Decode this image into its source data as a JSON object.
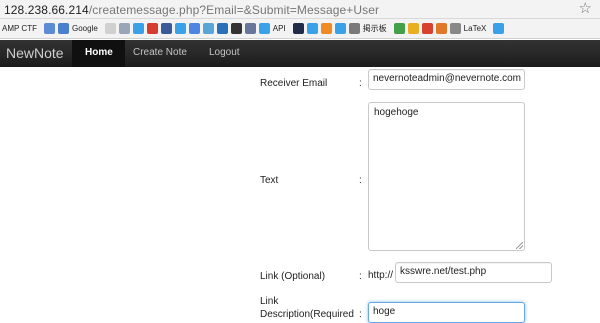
{
  "browser": {
    "url_host": "128.238.66.214",
    "url_path": "/createmessage.php?Email=&Submit=Message+User"
  },
  "bookmarks": [
    {
      "label": "AMP CTF",
      "icon": "none",
      "color": ""
    },
    {
      "label": "",
      "icon": "bookmark-icon",
      "color": "#5b8dd6"
    },
    {
      "label": "Google",
      "icon": "google-icon",
      "color": "#4a7fd0"
    },
    {
      "label": "",
      "icon": "page-icon",
      "color": "#d0d0d0"
    },
    {
      "label": "",
      "icon": "file-icon",
      "color": "#9aa6b8"
    },
    {
      "label": "",
      "icon": "twitter-icon",
      "color": "#3aa0e8"
    },
    {
      "label": "",
      "icon": "gmail-icon",
      "color": "#d63b2f"
    },
    {
      "label": "",
      "icon": "facebook-icon",
      "color": "#3b5998"
    },
    {
      "label": "",
      "icon": "twitter-icon",
      "color": "#3aa0e8"
    },
    {
      "label": "",
      "icon": "calendar-icon",
      "color": "#4c86e0"
    },
    {
      "label": "",
      "icon": "app-icon",
      "color": "#58a6d8"
    },
    {
      "label": "",
      "icon": "w3c-icon",
      "color": "#2a6fb8"
    },
    {
      "label": "",
      "icon": "github-icon",
      "color": "#333333"
    },
    {
      "label": "",
      "icon": "shield-icon",
      "color": "#667799"
    },
    {
      "label": "API",
      "icon": "twitter-icon",
      "color": "#3aa0e8"
    },
    {
      "label": "",
      "icon": "k-icon",
      "color": "#1f2d4a"
    },
    {
      "label": "",
      "icon": "twitter-icon",
      "color": "#3aa0e8"
    },
    {
      "label": "",
      "icon": "blogger-icon",
      "color": "#f08a24"
    },
    {
      "label": "",
      "icon": "twitter-icon",
      "color": "#3aa0e8"
    },
    {
      "label": "掲示板",
      "icon": "board-icon",
      "color": "#7a7a7a"
    },
    {
      "label": "",
      "icon": "chart-icon",
      "color": "#42a04a"
    },
    {
      "label": "",
      "icon": "wand-icon",
      "color": "#e8b020"
    },
    {
      "label": "",
      "icon": "mail-icon",
      "color": "#d84030"
    },
    {
      "label": "",
      "icon": "bag-icon",
      "color": "#e07828"
    },
    {
      "label": "LaTeX",
      "icon": "latex-icon",
      "color": "#888888"
    },
    {
      "label": "",
      "icon": "twitter-icon",
      "color": "#3aa0e8"
    }
  ],
  "nav": {
    "brand": "NewNote",
    "home": "Home",
    "create_note": "Create Note",
    "logout": "Logout"
  },
  "form": {
    "receiver_label": "Receiver Email",
    "receiver_value": "nevernoteadmin@nevernote.com",
    "text_label": "Text",
    "text_value": "hogehoge",
    "link_label": "Link (Optional)",
    "link_prefix": "http://",
    "link_value": "ksswre.net/test.php",
    "desc_label_1": "Link",
    "desc_label_2": "Description(Required",
    "desc_value": "hoge",
    "colon": ":"
  }
}
